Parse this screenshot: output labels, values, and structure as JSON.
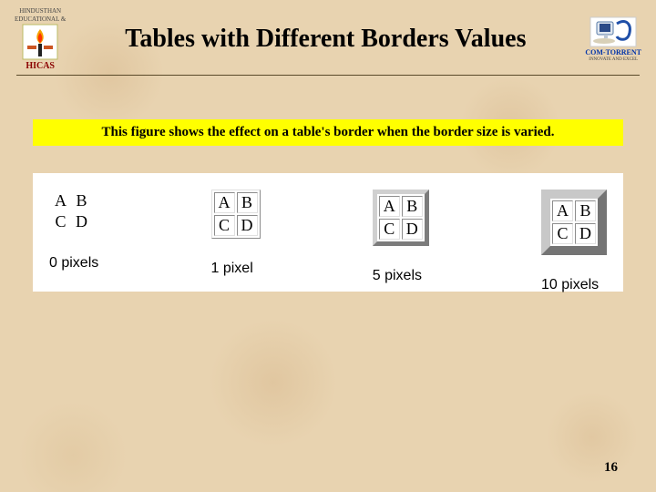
{
  "header": {
    "title": "Tables with Different Borders Values",
    "left_logo": {
      "line1": "HINDUSTHAN",
      "line2": "EDUCATIONAL &",
      "line3": "HICAS"
    },
    "right_logo": {
      "line1": "COM-TORRENT",
      "line2": "INNOVATE AND EXCEL"
    }
  },
  "caption": "This figure shows the effect on a table's border when the border size is varied.",
  "cells": {
    "a": "A",
    "b": "B",
    "c": "C",
    "d": "D"
  },
  "samples": [
    {
      "label": "0 pixels",
      "border_px": 0
    },
    {
      "label": "1 pixel",
      "border_px": 1
    },
    {
      "label": "5 pixels",
      "border_px": 5
    },
    {
      "label": "10 pixels",
      "border_px": 10
    }
  ],
  "page_number": "16"
}
